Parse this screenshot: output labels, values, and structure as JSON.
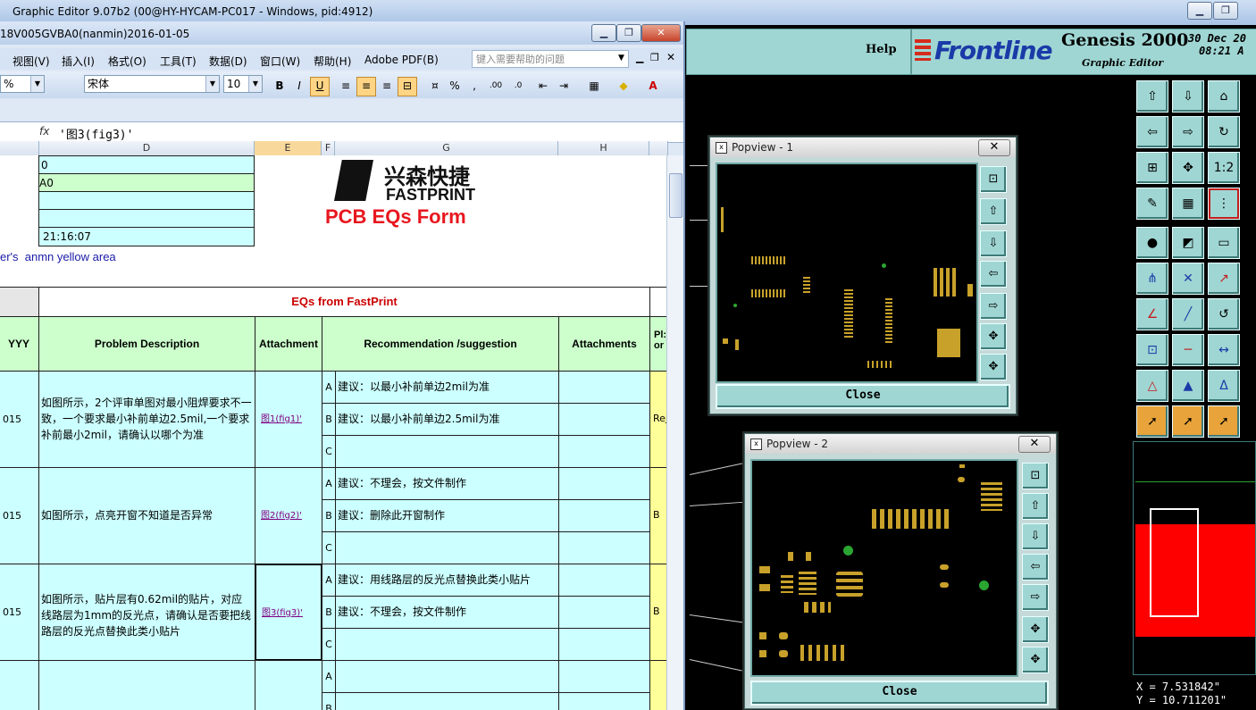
{
  "genesis": {
    "window_title": "Graphic Editor 9.07b2 (00@HY-HYCAM-PC017 - Windows, pid:4912)",
    "help_label": "Help",
    "brand": "Frontline",
    "product": "Genesis 2000",
    "subtitle": "Graphic Editor",
    "date": "30 Dec 20",
    "time": "08:21 A",
    "coord_x": "X = 7.531842\"",
    "coord_y": "Y = 10.711201\""
  },
  "popview1": {
    "title": "Popview - 1",
    "close_label": "Close"
  },
  "popview2": {
    "title": "Popview - 2",
    "close_label": "Close"
  },
  "excel": {
    "window_title": "18V005GVBA0(nanmin)2016-01-05",
    "menus": [
      "视图(V)",
      "插入(I)",
      "格式(O)",
      "工具(T)",
      "数据(D)",
      "窗口(W)",
      "帮助(H)",
      "Adobe PDF(B)"
    ],
    "help_search_placeholder": "键入需要帮助的问题",
    "zoom": "%",
    "font_name": "宋体",
    "font_size": "10",
    "formula_fx": "fx",
    "formula_value": "'图3(fig3)'",
    "columns": [
      "D",
      "E",
      "F",
      "G",
      "H"
    ],
    "info_cells": [
      "0",
      "A0",
      "",
      "",
      "21:16:07"
    ],
    "logo_cn": "兴森快捷",
    "logo_en": "FASTPRINT",
    "form_title": "PCB EQs Form",
    "yellow_area_note": "er's  anmn yellow area",
    "section_title": "EQs from FastPrint",
    "headers": {
      "date": "YYY",
      "problem": "Problem Description",
      "attachment": "Attachment",
      "recommendation": "Recommendation /suggestion",
      "attachments": "Attachments",
      "pl": "Pl: or"
    },
    "rows": [
      {
        "date": "015",
        "problem": "如图所示，2个评审单图对最小阻焊要求不一致，一个要求最小补前单边2.5mil,一个要求补前最小2mil，请确认以哪个为准",
        "attachment": "图1(fig1)'",
        "options": [
          {
            "letter": "A",
            "text": "建议：以最小补前单边2mil为准"
          },
          {
            "letter": "B",
            "text": "建议：以最小补前单边2.5mil为准"
          },
          {
            "letter": "C",
            "text": ""
          }
        ],
        "reply": "Rej"
      },
      {
        "date": "015",
        "problem": "如图所示，点亮开窗不知道是否异常",
        "attachment": "图2(fig2)'",
        "options": [
          {
            "letter": "A",
            "text": "建议：不理会，按文件制作"
          },
          {
            "letter": "B",
            "text": "建议：删除此开窗制作"
          },
          {
            "letter": "C",
            "text": ""
          }
        ],
        "reply": "B"
      },
      {
        "date": "015",
        "problem": "如图所示，贴片层有0.62mil的贴片，对应线路层为1mm的反光点，请确认是否要把线路层的反光点替换此类小贴片",
        "attachment": "图3(fig3)'",
        "options": [
          {
            "letter": "A",
            "text": "建议：用线路层的反光点替换此类小贴片"
          },
          {
            "letter": "B",
            "text": "建议：不理会，按文件制作"
          },
          {
            "letter": "C",
            "text": ""
          }
        ],
        "reply": "B"
      },
      {
        "date": "",
        "problem": "",
        "attachment": "",
        "options": [
          {
            "letter": "A",
            "text": ""
          },
          {
            "letter": "B",
            "text": ""
          }
        ],
        "reply": ""
      }
    ]
  },
  "colors": {
    "genesis_teal": "#9fd6d3",
    "excel_header_green": "#ccffcc",
    "excel_cyan": "#ccffff",
    "excel_yellow": "#ffff99",
    "form_title_red": "#e8171f",
    "section_title_red": "#cc0000",
    "pad_gold": "#c8a12a",
    "minimap_red": "#ff0000"
  }
}
